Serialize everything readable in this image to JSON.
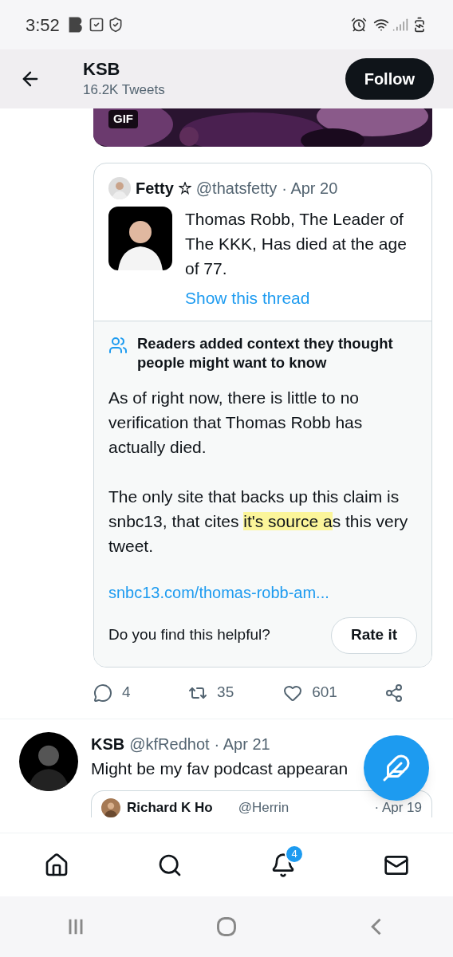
{
  "status_bar": {
    "time": "3:52"
  },
  "header": {
    "title": "KSB",
    "subtitle": "16.2K Tweets",
    "follow_button": "Follow"
  },
  "media": {
    "kind": "picture",
    "badge": "GIF"
  },
  "quoted_tweet": {
    "name": "Fetty",
    "handle": "@thatsfetty",
    "date": "· Apr 20",
    "text": "Thomas Robb, The Leader of The KKK, Has died at the age of 77.",
    "thread_link": "Show this thread"
  },
  "context_note": {
    "heading": "Readers added context they thought people might want to know",
    "paragraph_1": "As of right now, there is little to no verification that Thomas Robb has actually died.",
    "paragraph_2": {
      "before": "The only site that backs up this claim is snbc13, that cites ",
      "highlighted": "it's source a",
      "after": "s this very tweet."
    },
    "link": "snbc13.com/thomas-robb-am...",
    "question": "Do you find this helpful?",
    "rate_button": "Rate it"
  },
  "actions": [
    {
      "kind": "reply",
      "count": "4"
    },
    {
      "kind": "retweet",
      "count": "35"
    },
    {
      "kind": "like",
      "count": "601"
    },
    {
      "kind": "share"
    }
  ],
  "next_tweet": {
    "name": "KSB",
    "handle": "@kfRedhot",
    "date": "· Apr 21",
    "text": "Might be my fav podcast appearan",
    "quote_name": "Richard K Ho",
    "quote_handle": "@Herrin",
    "quote_date": "· Apr 19"
  },
  "bottom_nav": [
    {
      "kind": "home"
    },
    {
      "kind": "search"
    },
    {
      "kind": "notifications",
      "badge": "4"
    },
    {
      "kind": "messages"
    }
  ]
}
